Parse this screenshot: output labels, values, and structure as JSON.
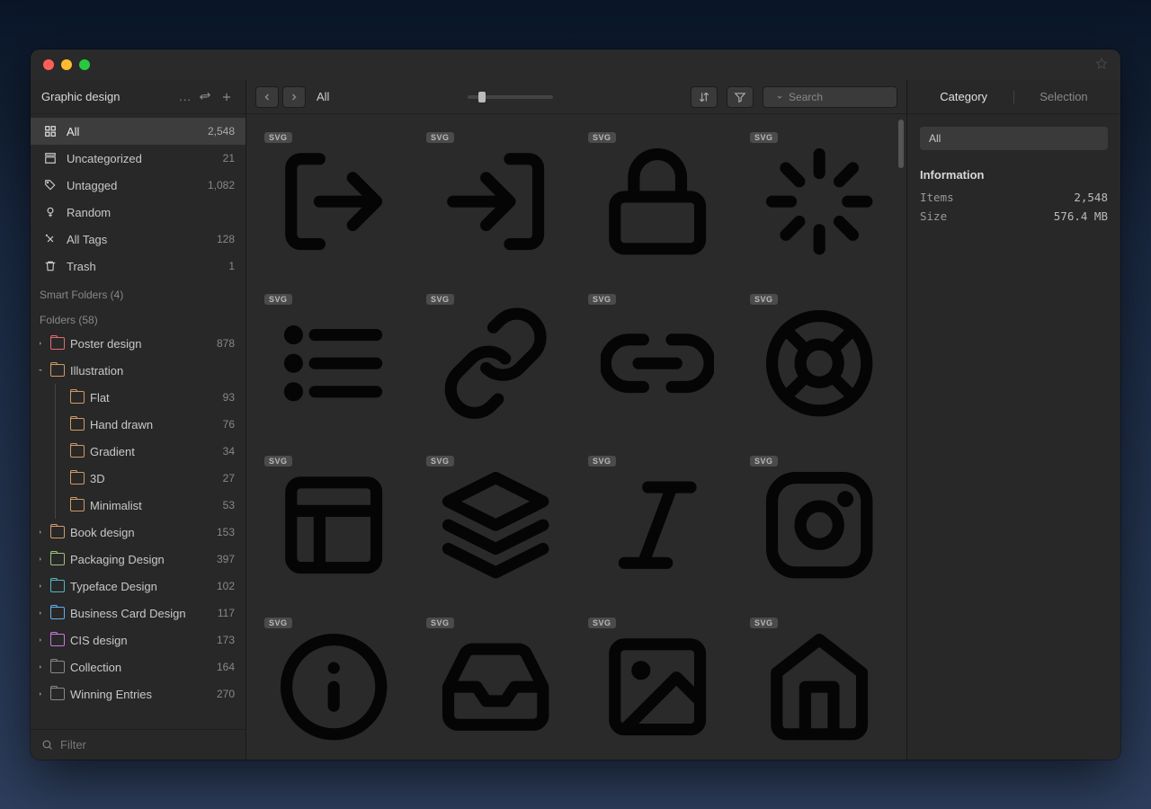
{
  "window": {
    "library_name": "Graphic design"
  },
  "sidebar": {
    "filter_placeholder": "Filter",
    "smart_folders_label": "Smart Folders (4)",
    "folders_label": "Folders (58)",
    "items": [
      {
        "icon": "all",
        "label": "All",
        "count": "2,548",
        "active": true
      },
      {
        "icon": "uncat",
        "label": "Uncategorized",
        "count": "21"
      },
      {
        "icon": "untag",
        "label": "Untagged",
        "count": "1,082"
      },
      {
        "icon": "random",
        "label": "Random",
        "count": ""
      },
      {
        "icon": "tags",
        "label": "All Tags",
        "count": "128"
      },
      {
        "icon": "trash",
        "label": "Trash",
        "count": "1"
      }
    ],
    "folders": [
      {
        "label": "Poster design",
        "count": "878",
        "color": "fc-red",
        "expanded": false
      },
      {
        "label": "Illustration",
        "count": "",
        "color": "fc-orange",
        "expanded": true,
        "children": [
          {
            "label": "Flat",
            "count": "93",
            "color": "fc-orange"
          },
          {
            "label": "Hand drawn",
            "count": "76",
            "color": "fc-orange"
          },
          {
            "label": "Gradient",
            "count": "34",
            "color": "fc-orange"
          },
          {
            "label": "3D",
            "count": "27",
            "color": "fc-orange"
          },
          {
            "label": "Minimalist",
            "count": "53",
            "color": "fc-orange"
          }
        ]
      },
      {
        "label": "Book design",
        "count": "153",
        "color": "fc-orange",
        "expanded": false
      },
      {
        "label": "Packaging Design",
        "count": "397",
        "color": "fc-green",
        "expanded": false
      },
      {
        "label": "Typeface Design",
        "count": "102",
        "color": "fc-cyan",
        "expanded": false
      },
      {
        "label": "Business Card Design",
        "count": "117",
        "color": "fc-blue",
        "expanded": false
      },
      {
        "label": "CIS design",
        "count": "173",
        "color": "fc-purple",
        "expanded": false
      },
      {
        "label": "Collection",
        "count": "164",
        "color": "fc-gray",
        "expanded": false
      },
      {
        "label": "Winning Entries",
        "count": "270",
        "color": "fc-gray",
        "expanded": false
      }
    ]
  },
  "toolbar": {
    "breadcrumb": "All",
    "search_placeholder": "Search"
  },
  "grid": {
    "badge": "SVG",
    "icons": [
      "logout",
      "login",
      "lock",
      "loader",
      "list",
      "link",
      "link2",
      "lifebuoy",
      "layout",
      "layers",
      "italic",
      "instagram",
      "info",
      "inbox",
      "image",
      "home"
    ]
  },
  "rightpanel": {
    "tabs": {
      "category": "Category",
      "selection": "Selection"
    },
    "chip": "All",
    "info_title": "Information",
    "rows": [
      {
        "label": "Items",
        "value": "2,548"
      },
      {
        "label": "Size",
        "value": "576.4 MB"
      }
    ]
  }
}
